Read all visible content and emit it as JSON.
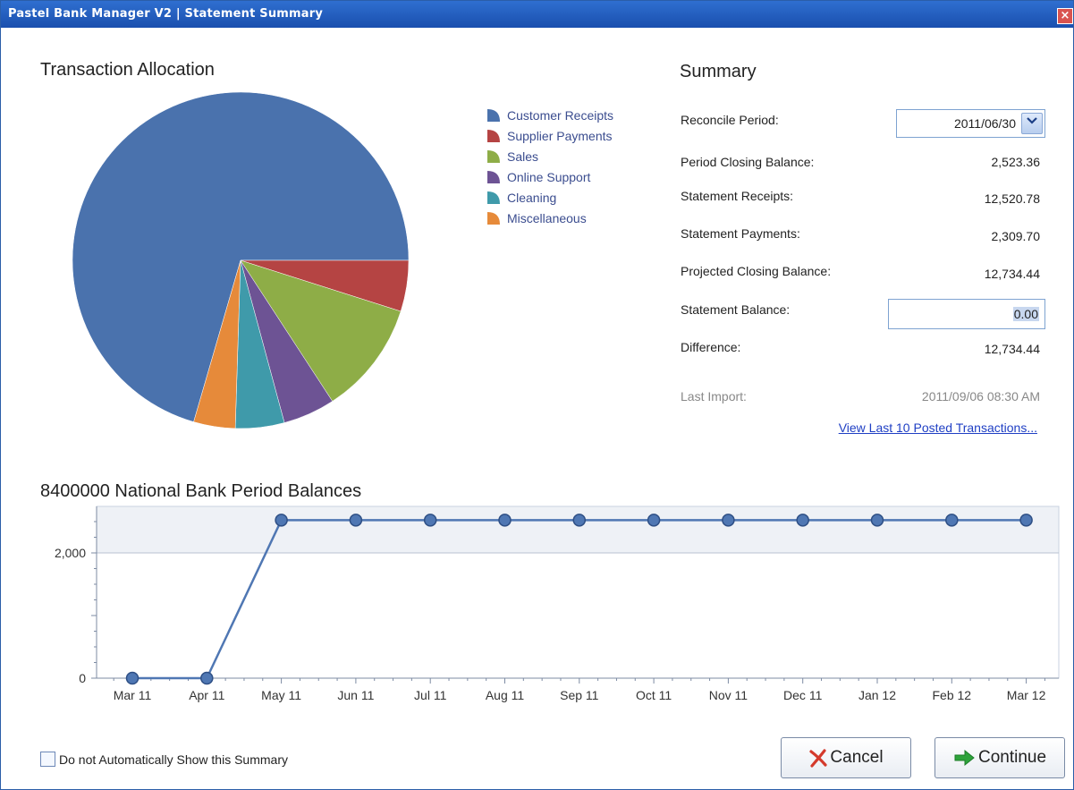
{
  "window": {
    "title": "Pastel Bank Manager V2 | Statement Summary"
  },
  "allocation": {
    "heading": "Transaction Allocation"
  },
  "legend": [
    {
      "label": "Customer Receipts",
      "color": "#4a72ad"
    },
    {
      "label": "Supplier Payments",
      "color": "#b54443"
    },
    {
      "label": "Sales",
      "color": "#8ead47"
    },
    {
      "label": "Online Support",
      "color": "#6d5394"
    },
    {
      "label": "Cleaning",
      "color": "#3f9aaa"
    },
    {
      "label": "Miscellaneous",
      "color": "#e68a3a"
    }
  ],
  "summary": {
    "heading": "Summary",
    "reconcile_label": "Reconcile Period:",
    "reconcile_value": "2011/06/30",
    "closing_label": "Period Closing Balance:",
    "closing_value": "2,523.36",
    "receipts_label": "Statement Receipts:",
    "receipts_value": "12,520.78",
    "payments_label": "Statement Payments:",
    "payments_value": "2,309.70",
    "projected_label": "Projected Closing Balance:",
    "projected_value": "12,734.44",
    "statement_balance_label": "Statement Balance:",
    "statement_balance_value": "0.00",
    "difference_label": "Difference:",
    "difference_value": "12,734.44",
    "last_import_label": "Last Import:",
    "last_import_value": "2011/09/06 08:30 AM",
    "link_label": "View Last 10 Posted Transactions..."
  },
  "balances": {
    "heading": "8400000 National Bank Period Balances"
  },
  "footer": {
    "checkbox_label": "Do not Automatically Show this Summary",
    "checkbox_checked": false,
    "cancel_label": "Cancel",
    "continue_label": "Continue"
  },
  "chart_data": [
    {
      "type": "pie",
      "categories": [
        "Customer Receipts",
        "Supplier Payments",
        "Sales",
        "Online Support",
        "Cleaning",
        "Miscellaneous"
      ],
      "values": [
        70.5,
        4.9,
        10.9,
        5.0,
        4.7,
        4.0
      ],
      "colors": [
        "#4a72ad",
        "#b54443",
        "#8ead47",
        "#6d5394",
        "#3f9aaa",
        "#e68a3a"
      ],
      "legend": "right"
    },
    {
      "type": "line",
      "title": "8400000 National Bank Period Balances",
      "x": [
        "Mar 11",
        "Apr 11",
        "May 11",
        "Jun 11",
        "Jul 11",
        "Aug 11",
        "Sep 11",
        "Oct 11",
        "Nov 11",
        "Dec 11",
        "Jan 12",
        "Feb 12",
        "Mar 12"
      ],
      "series": [
        {
          "values": [
            0,
            0,
            2523.36,
            2523.36,
            2523.36,
            2523.36,
            2523.36,
            2523.36,
            2523.36,
            2523.36,
            2523.36,
            2523.36,
            2523.36
          ]
        }
      ],
      "yticks": [
        "0",
        "2,000"
      ],
      "ylim": [
        0,
        2600
      ],
      "grid": true,
      "color": "#4f77b3"
    }
  ]
}
